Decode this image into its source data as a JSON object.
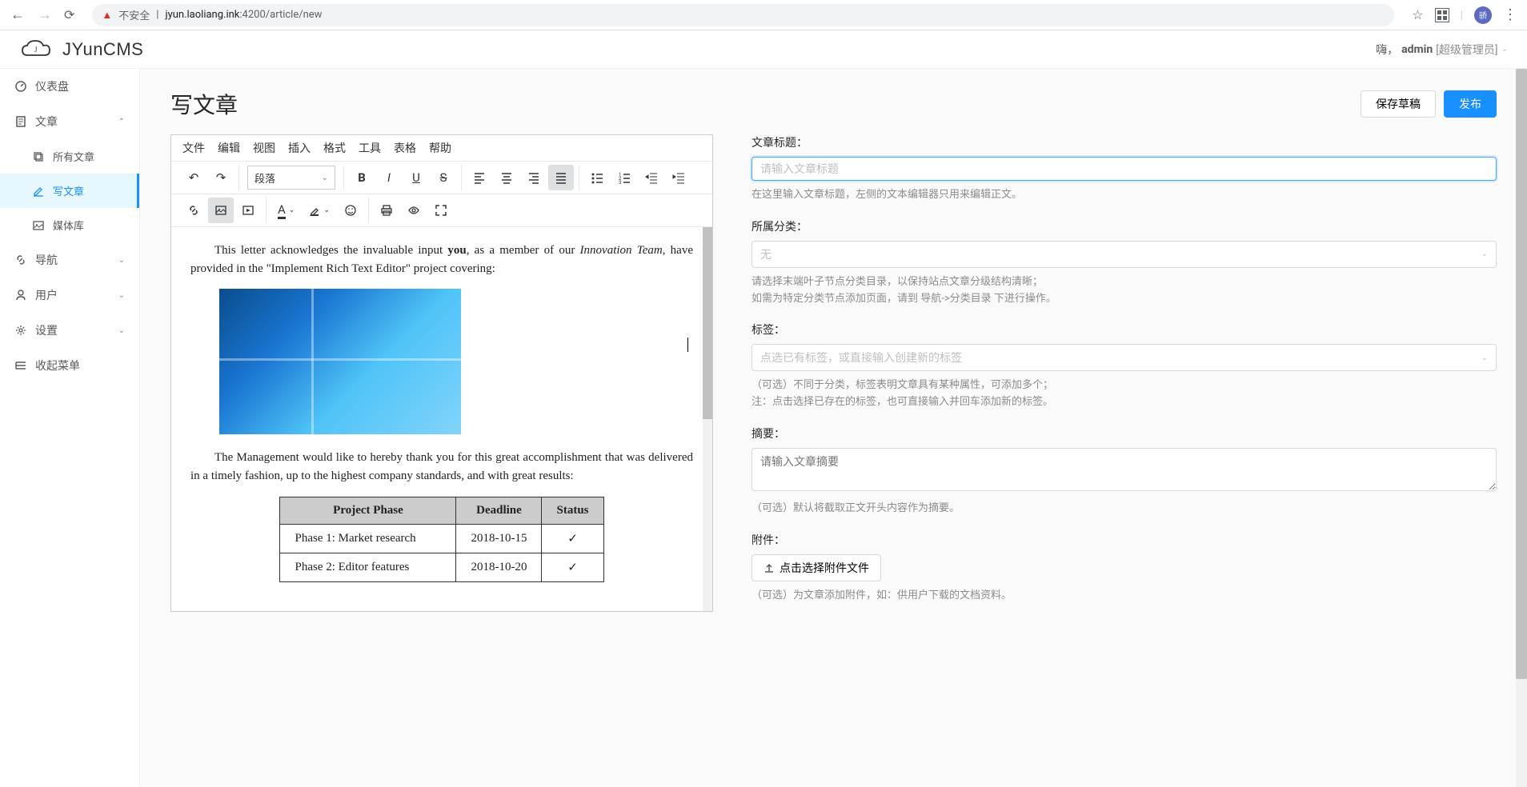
{
  "browser": {
    "not_secure": "不安全",
    "url_host": "jyun.laoliang.ink",
    "url_port": ":4200",
    "url_path": "/article/new",
    "avatar_char": "骄"
  },
  "header": {
    "logo": "JYunCMS",
    "greeting_prefix": "嗨，",
    "username": "admin",
    "role": "[超级管理员]"
  },
  "sidebar": {
    "dashboard": "仪表盘",
    "article": "文章",
    "all_articles": "所有文章",
    "write_article": "写文章",
    "media": "媒体库",
    "nav": "导航",
    "user": "用户",
    "settings": "设置",
    "collapse": "收起菜单"
  },
  "page": {
    "title": "写文章",
    "save_draft": "保存草稿",
    "publish": "发布"
  },
  "editor": {
    "menu": {
      "file": "文件",
      "edit": "编辑",
      "view": "视图",
      "insert": "插入",
      "format": "格式",
      "tools": "工具",
      "table": "表格",
      "help": "帮助"
    },
    "block_format": "段落",
    "content": {
      "p1_a": "This letter acknowledges the invaluable input ",
      "p1_you": "you",
      "p1_b": ", as a member of our ",
      "p1_team": "Innovation Team",
      "p1_c": ", have provided in the \"Implement Rich Text Editor\" project covering:",
      "p2": "The Management would like to hereby thank you for this great accomplishment that was delivered in a timely fashion, up to the highest company standards, and with great results:",
      "table": {
        "h1": "Project Phase",
        "h2": "Deadline",
        "h3": "Status",
        "r1c1": "Phase 1: Market research",
        "r1c2": "2018-10-15",
        "r1c3": "✓",
        "r2c1": "Phase 2: Editor features",
        "r2c2": "2018-10-20",
        "r2c3": "✓"
      }
    }
  },
  "form": {
    "title_label": "文章标题：",
    "title_placeholder": "请输入文章标题",
    "title_hint": "在这里输入文章标题，左侧的文本编辑器只用来编辑正文。",
    "category_label": "所属分类：",
    "category_placeholder": "无",
    "category_hint1": "请选择末端叶子节点分类目录，以保持站点文章分级结构清晰；",
    "category_hint2": "如需为特定分类节点添加页面，请到 导航->分类目录 下进行操作。",
    "tags_label": "标签：",
    "tags_placeholder": "点选已有标签，或直接输入创建新的标签",
    "tags_hint1": "（可选）不同于分类，标签表明文章具有某种属性，可添加多个；",
    "tags_hint2": "注：点击选择已存在的标签，也可直接输入并回车添加新的标签。",
    "summary_label": "摘要：",
    "summary_placeholder": "请输入文章摘要",
    "summary_hint": "（可选）默认将截取正文开头内容作为摘要。",
    "attach_label": "附件：",
    "attach_btn": "点击选择附件文件",
    "attach_hint": "（可选）为文章添加附件，如：供用户下载的文档资料。"
  }
}
